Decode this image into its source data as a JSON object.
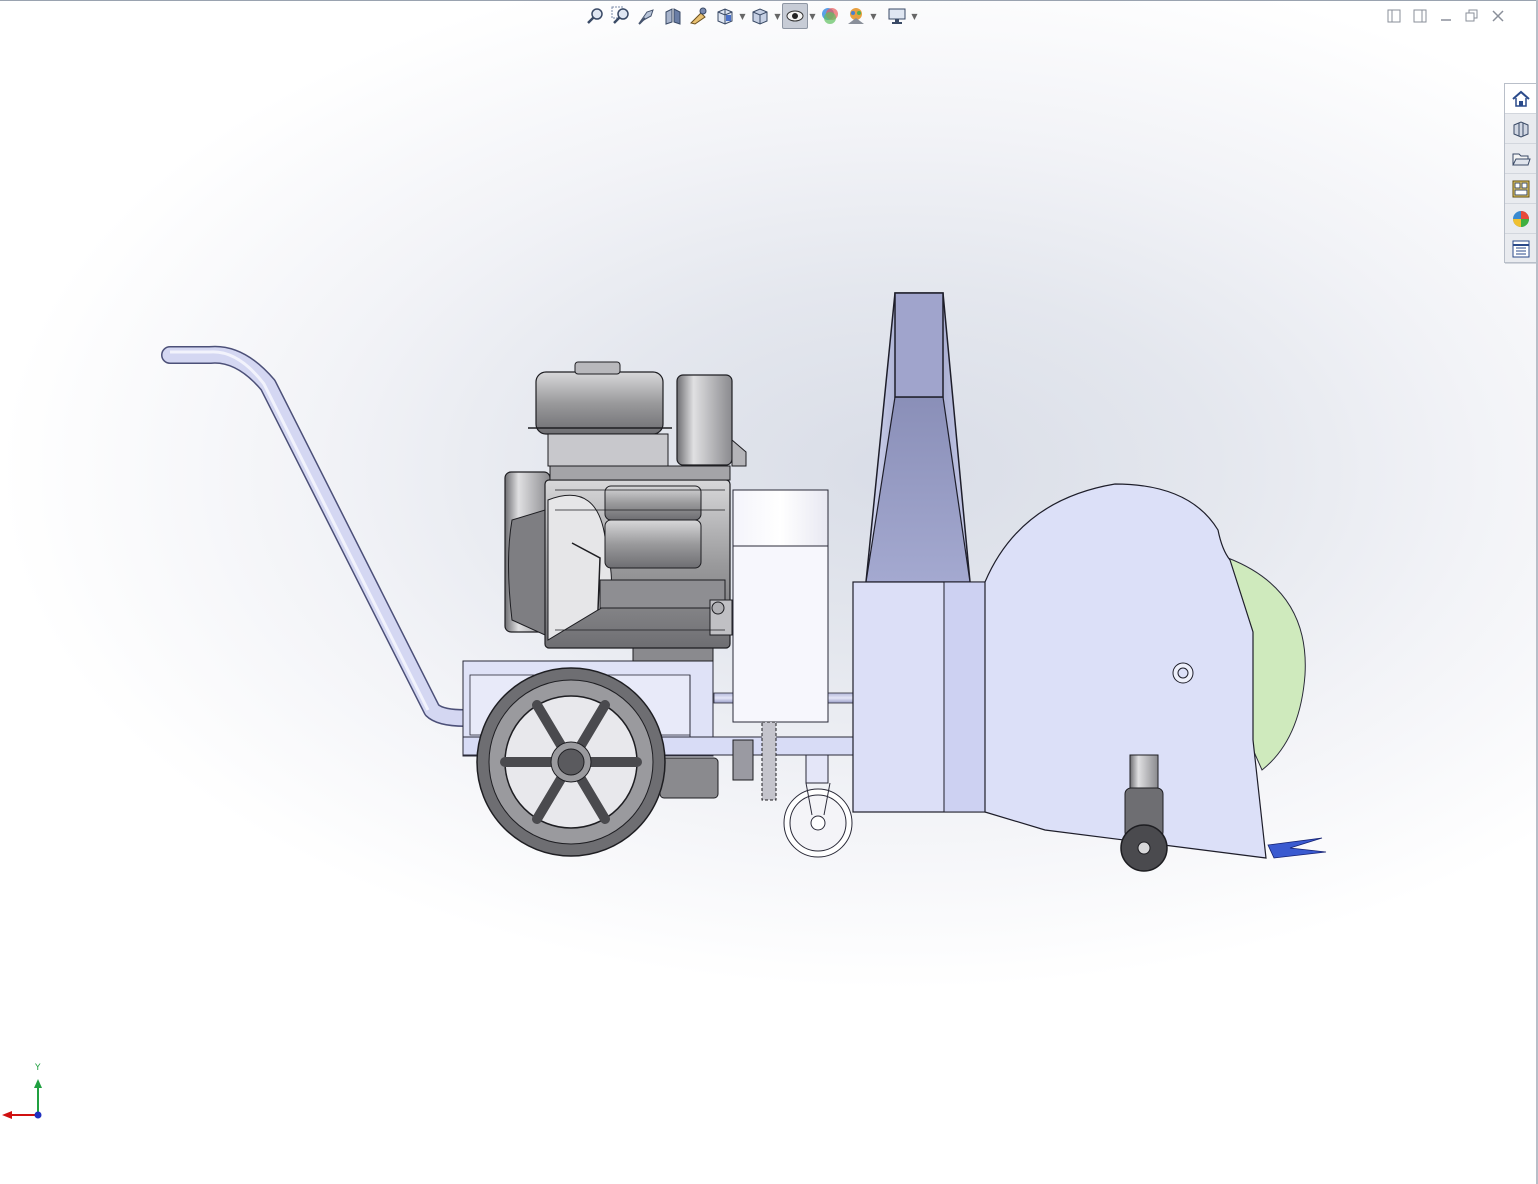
{
  "toolbar": {
    "items": [
      {
        "icon": "zoom-to-fit-icon"
      },
      {
        "icon": "zoom-to-area-icon"
      },
      {
        "icon": "previous-view-icon"
      },
      {
        "icon": "section-view-icon"
      },
      {
        "icon": "dynamic-annotation-icon"
      },
      {
        "icon": "view-orientation-icon",
        "dropdown": true
      },
      {
        "icon": "display-style-icon",
        "dropdown": true
      },
      {
        "icon": "hide-show-items-icon",
        "dropdown": true,
        "active": true
      },
      {
        "icon": "edit-appearance-icon"
      },
      {
        "icon": "apply-scene-icon",
        "dropdown": true
      },
      {
        "icon": "view-settings-icon",
        "dropdown": true
      }
    ]
  },
  "window_controls": [
    "tile-left-icon",
    "tile-right-icon",
    "minimize-icon",
    "restore-icon",
    "close-icon"
  ],
  "task_pane": {
    "items": [
      {
        "icon": "home-icon",
        "active": true
      },
      {
        "icon": "design-library-icon"
      },
      {
        "icon": "file-explorer-icon"
      },
      {
        "icon": "view-palette-icon"
      },
      {
        "icon": "appearances-icon"
      },
      {
        "icon": "custom-properties-icon"
      }
    ]
  },
  "triad": {
    "y_label": "Y",
    "colors": {
      "y": "#20a040",
      "x": "#d01010",
      "origin": "#2030c0"
    }
  },
  "model": {
    "colors": {
      "frame": "#d8dcf6",
      "engine": "#9a9a9c",
      "shield": "#cfeabd",
      "blade": "#3a5ad0"
    }
  }
}
